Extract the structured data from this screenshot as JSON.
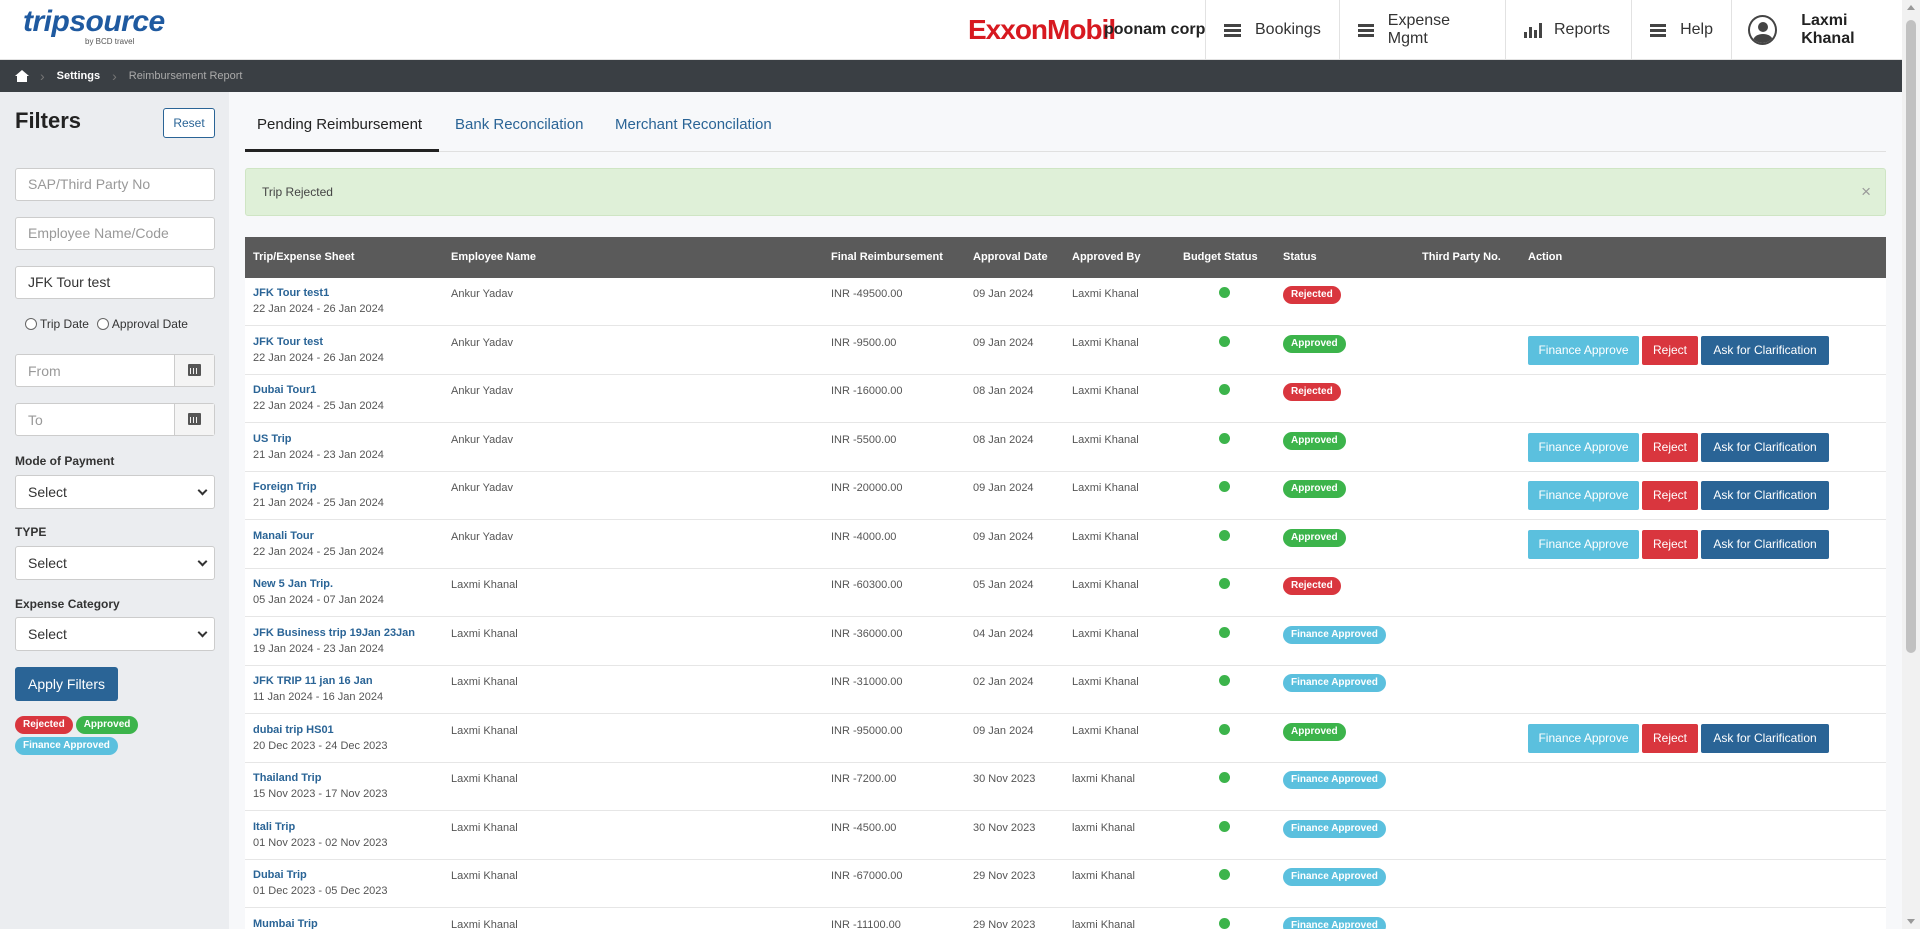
{
  "header": {
    "logo_text": "tripsource",
    "logo_sub": "by BCD travel",
    "brand": "ExxonMobil",
    "company": "poonam corp",
    "nav": [
      {
        "label": "Bookings",
        "icon": "hamburger-icon"
      },
      {
        "label": "Expense Mgmt",
        "icon": "hamburger-icon"
      },
      {
        "label": "Reports",
        "icon": "bar-chart-icon"
      },
      {
        "label": "Help",
        "icon": "hamburger-icon"
      }
    ],
    "user_name": "Laxmi Khanal"
  },
  "breadcrumb": {
    "items": [
      "Settings",
      "Reimbursement Report"
    ]
  },
  "filters": {
    "title": "Filters",
    "reset_label": "Reset",
    "sap_placeholder": "SAP/Third Party No",
    "employee_placeholder": "Employee Name/Code",
    "trip_value": "JFK Tour test",
    "radio_trip_date": "Trip Date",
    "radio_approval_date": "Approval Date",
    "from_placeholder": "From",
    "to_placeholder": "To",
    "mode_label": "Mode of Payment",
    "mode_value": "Select",
    "type_label": "TYPE",
    "type_value": "Select",
    "category_label": "Expense Category",
    "category_value": "Select",
    "apply_label": "Apply Filters",
    "legend": [
      "Rejected",
      "Approved",
      "Finance Approved"
    ]
  },
  "tabs": [
    "Pending Reimbursement",
    "Bank Reconcilation",
    "Merchant Reconcilation"
  ],
  "alert": {
    "text": "Trip Rejected",
    "close": "×"
  },
  "table": {
    "headers": [
      "Trip/Expense Sheet",
      "Employee Name",
      "Final Reimbursement",
      "Approval Date",
      "Approved By",
      "Budget Status",
      "Status",
      "Third Party No.",
      "Action"
    ],
    "action_labels": {
      "finance": "Finance Approve",
      "reject": "Reject",
      "clarify": "Ask for Clarification"
    },
    "rows": [
      {
        "trip": "JFK Tour test1",
        "dates": "22 Jan 2024 - 26 Jan 2024",
        "employee": "Ankur Yadav",
        "amount": "INR -49500.00",
        "approval_date": "09 Jan 2024",
        "approved_by": "Laxmi Khanal",
        "status": "Rejected",
        "actions": false
      },
      {
        "trip": "JFK Tour test",
        "dates": "22 Jan 2024 - 26 Jan 2024",
        "employee": "Ankur Yadav",
        "amount": "INR -9500.00",
        "approval_date": "09 Jan 2024",
        "approved_by": "Laxmi Khanal",
        "status": "Approved",
        "actions": true
      },
      {
        "trip": "Dubai Tour1",
        "dates": "22 Jan 2024 - 25 Jan 2024",
        "employee": "Ankur Yadav",
        "amount": "INR -16000.00",
        "approval_date": "08 Jan 2024",
        "approved_by": "Laxmi Khanal",
        "status": "Rejected",
        "actions": false
      },
      {
        "trip": "US Trip",
        "dates": "21 Jan 2024 - 23 Jan 2024",
        "employee": "Ankur Yadav",
        "amount": "INR -5500.00",
        "approval_date": "08 Jan 2024",
        "approved_by": "Laxmi Khanal",
        "status": "Approved",
        "actions": true
      },
      {
        "trip": "Foreign Trip",
        "dates": "21 Jan 2024 - 25 Jan 2024",
        "employee": "Ankur Yadav",
        "amount": "INR -20000.00",
        "approval_date": "09 Jan 2024",
        "approved_by": "Laxmi Khanal",
        "status": "Approved",
        "actions": true
      },
      {
        "trip": "Manali Tour",
        "dates": "22 Jan 2024 - 25 Jan 2024",
        "employee": "Ankur Yadav",
        "amount": "INR -4000.00",
        "approval_date": "09 Jan 2024",
        "approved_by": "Laxmi Khanal",
        "status": "Approved",
        "actions": true
      },
      {
        "trip": "New 5 Jan Trip.",
        "dates": "05 Jan 2024 - 07 Jan 2024",
        "employee": "Laxmi Khanal",
        "amount": "INR -60300.00",
        "approval_date": "05 Jan 2024",
        "approved_by": "Laxmi Khanal",
        "status": "Rejected",
        "actions": false
      },
      {
        "trip": "JFK Business trip 19Jan 23Jan",
        "dates": "19 Jan 2024 - 23 Jan 2024",
        "employee": "Laxmi Khanal",
        "amount": "INR -36000.00",
        "approval_date": "04 Jan 2024",
        "approved_by": "Laxmi Khanal",
        "status": "Finance Approved",
        "actions": false
      },
      {
        "trip": "JFK TRIP 11 jan 16 Jan",
        "dates": "11 Jan 2024 - 16 Jan 2024",
        "employee": "Laxmi Khanal",
        "amount": "INR -31000.00",
        "approval_date": "02 Jan 2024",
        "approved_by": "Laxmi Khanal",
        "status": "Finance Approved",
        "actions": false
      },
      {
        "trip": "dubai trip HS01",
        "dates": "20 Dec 2023 - 24 Dec 2023",
        "employee": "Laxmi Khanal",
        "amount": "INR -95000.00",
        "approval_date": "09 Jan 2024",
        "approved_by": "Laxmi Khanal",
        "status": "Approved",
        "actions": true
      },
      {
        "trip": "Thailand Trip",
        "dates": "15 Nov 2023 - 17 Nov 2023",
        "employee": "Laxmi Khanal",
        "amount": "INR -7200.00",
        "approval_date": "30 Nov 2023",
        "approved_by": "laxmi Khanal",
        "status": "Finance Approved",
        "actions": false
      },
      {
        "trip": "Itali Trip",
        "dates": "01 Nov 2023 - 02 Nov 2023",
        "employee": "Laxmi Khanal",
        "amount": "INR -4500.00",
        "approval_date": "30 Nov 2023",
        "approved_by": "laxmi Khanal",
        "status": "Finance Approved",
        "actions": false
      },
      {
        "trip": "Dubai Trip",
        "dates": "01 Dec 2023 - 05 Dec 2023",
        "employee": "Laxmi Khanal",
        "amount": "INR -67000.00",
        "approval_date": "29 Nov 2023",
        "approved_by": "laxmi Khanal",
        "status": "Finance Approved",
        "actions": false
      },
      {
        "trip": "Mumbai Trip",
        "dates": "",
        "employee": "Laxmi Khanal",
        "amount": "INR -11100.00",
        "approval_date": "29 Nov 2023",
        "approved_by": "laxmi Khanal",
        "status": "Finance Approved",
        "actions": false
      }
    ]
  },
  "colors": {
    "primary": "#2a6496",
    "rejected": "#d9363e",
    "approved": "#3cb44b",
    "finance_approved": "#5bc0de",
    "header_bg": "#5a5a5a",
    "breadcrumb_bg": "#3a3f44",
    "brand_red": "#d71920"
  }
}
